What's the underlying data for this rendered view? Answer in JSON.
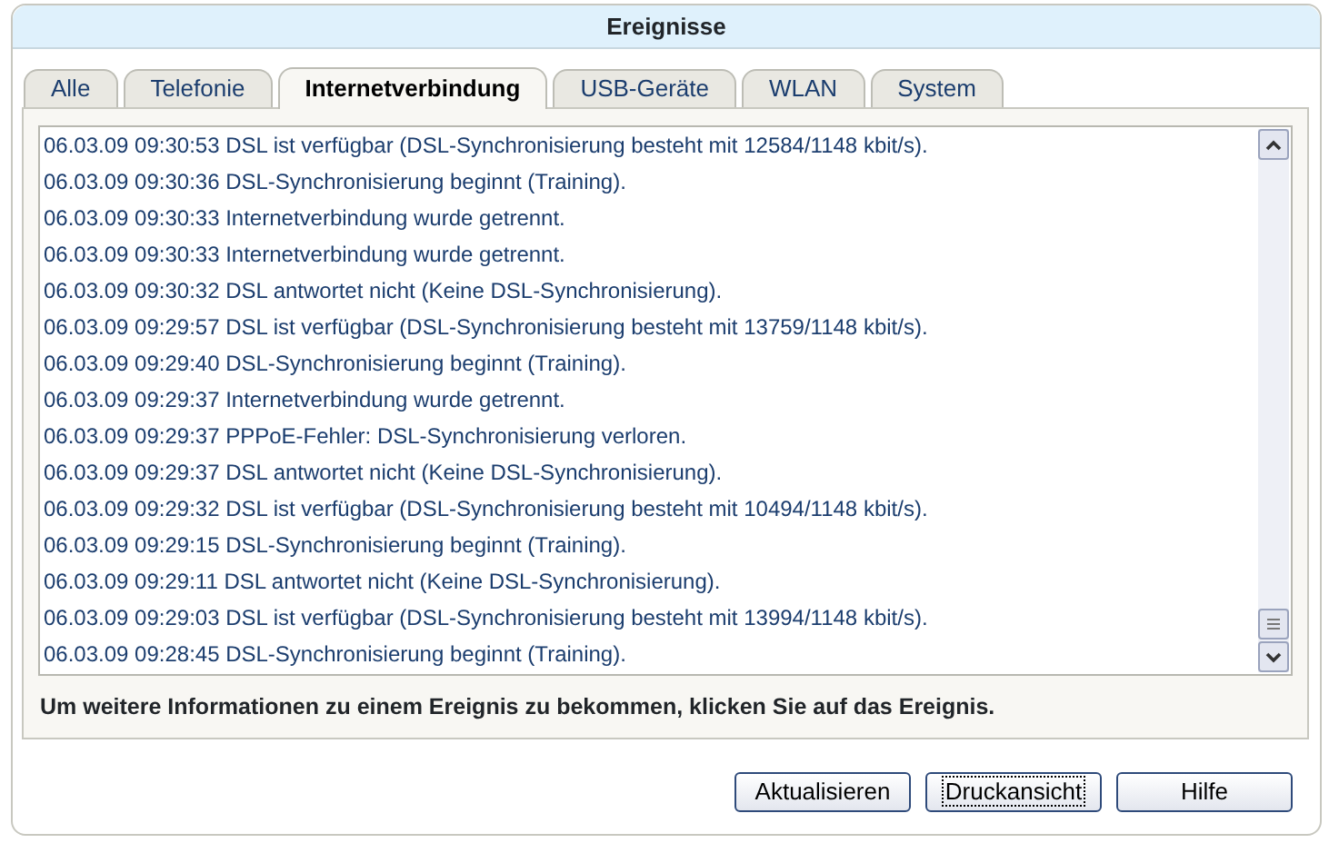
{
  "window": {
    "title": "Ereignisse"
  },
  "tabs": [
    {
      "label": "Alle",
      "selected": false
    },
    {
      "label": "Telefonie",
      "selected": false
    },
    {
      "label": "Internetverbindung",
      "selected": true
    },
    {
      "label": "USB-Geräte",
      "selected": false
    },
    {
      "label": "WLAN",
      "selected": false
    },
    {
      "label": "System",
      "selected": false
    }
  ],
  "events": [
    "06.03.09 09:30:53 DSL ist verfügbar (DSL-Synchronisierung besteht mit 12584/1148 kbit/s).",
    "06.03.09 09:30:36 DSL-Synchronisierung beginnt (Training).",
    "06.03.09 09:30:33 Internetverbindung wurde getrennt.",
    "06.03.09 09:30:33 Internetverbindung wurde getrennt.",
    "06.03.09 09:30:32 DSL antwortet nicht (Keine DSL-Synchronisierung).",
    "06.03.09 09:29:57 DSL ist verfügbar (DSL-Synchronisierung besteht mit 13759/1148 kbit/s).",
    "06.03.09 09:29:40 DSL-Synchronisierung beginnt (Training).",
    "06.03.09 09:29:37 Internetverbindung wurde getrennt.",
    "06.03.09 09:29:37 PPPoE-Fehler: DSL-Synchronisierung verloren.",
    "06.03.09 09:29:37 DSL antwortet nicht (Keine DSL-Synchronisierung).",
    "06.03.09 09:29:32 DSL ist verfügbar (DSL-Synchronisierung besteht mit 10494/1148 kbit/s).",
    "06.03.09 09:29:15 DSL-Synchronisierung beginnt (Training).",
    "06.03.09 09:29:11 DSL antwortet nicht (Keine DSL-Synchronisierung).",
    "06.03.09 09:29:03 DSL ist verfügbar (DSL-Synchronisierung besteht mit 13994/1148 kbit/s).",
    "06.03.09 09:28:45 DSL-Synchronisierung beginnt (Training)."
  ],
  "hint": "Um weitere Informationen zu einem Ereignis zu bekommen, klicken Sie auf das Ereignis.",
  "buttons": [
    {
      "label": "Aktualisieren",
      "focused": false
    },
    {
      "label": "Druckansicht",
      "focused": true
    },
    {
      "label": "Hilfe",
      "focused": false
    }
  ]
}
